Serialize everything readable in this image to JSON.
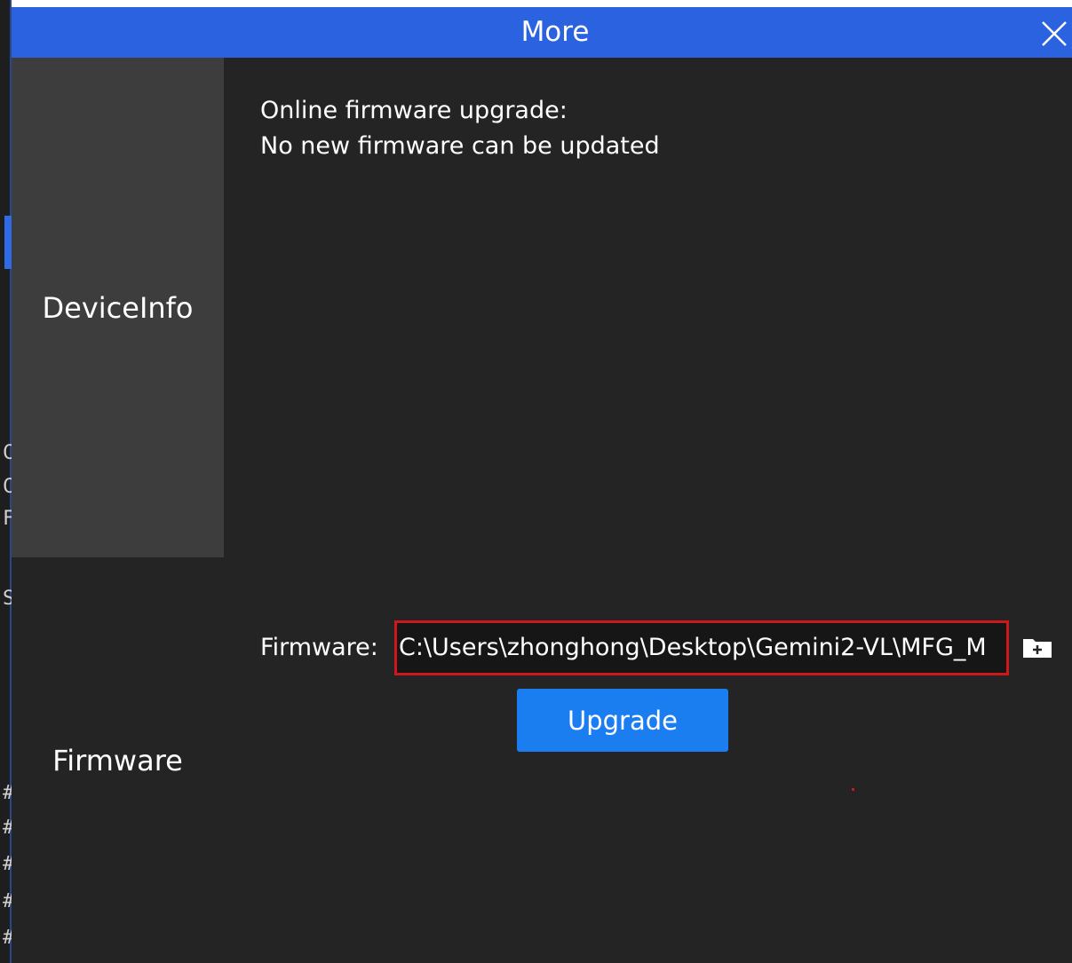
{
  "dialog": {
    "title": "More",
    "close_icon": "close-icon"
  },
  "sidebar": {
    "items": [
      {
        "label": "DeviceInfo",
        "active": true
      },
      {
        "label": "Firmware",
        "active": false
      }
    ]
  },
  "firmware": {
    "online_title": "Online firmware upgrade:",
    "online_status": "No new firmware can be updated",
    "label": "Firmware:",
    "path_value": "C:\\Users\\zhonghong\\Desktop\\Gemini2-VL\\MFG_M",
    "browse_icon": "folder-add-icon",
    "upgrade_label": "Upgrade"
  },
  "background": {
    "glyphs": [
      "C",
      "C",
      "F",
      "S",
      "#",
      "#",
      "#",
      "#",
      "#"
    ]
  },
  "colors": {
    "title_bar": "#2b62e0",
    "dialog_bg": "#242424",
    "sidebar_active": "#3d3d3d",
    "upgrade_button": "#1a7ef0",
    "highlight_border": "#d0181c"
  }
}
